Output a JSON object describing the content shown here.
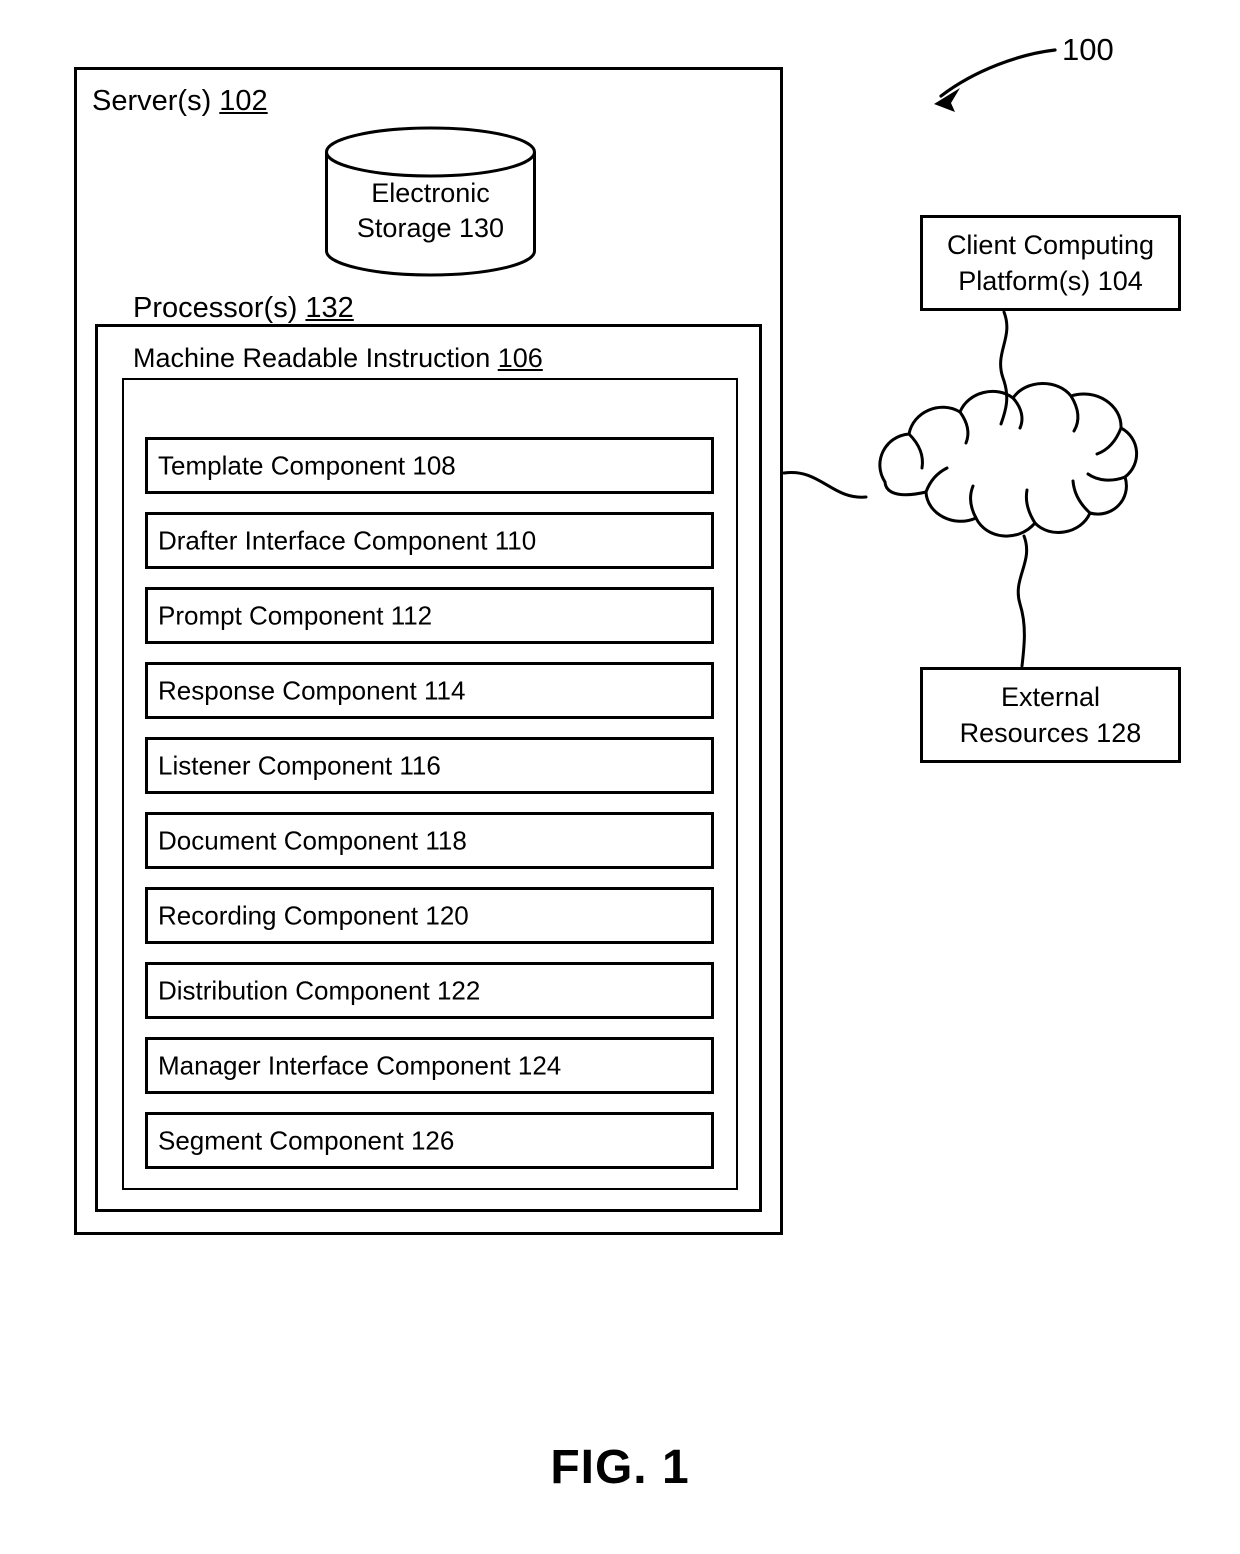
{
  "figure": {
    "caption": "FIG. 1",
    "reference_numeral": "100"
  },
  "server": {
    "label": "Server(s)",
    "ref": "102"
  },
  "storage": {
    "line1": "Electronic",
    "line2": "Storage",
    "ref": "130"
  },
  "processor": {
    "label": "Processor(s)",
    "ref": "132"
  },
  "machine_readable_instruction": {
    "label": "Machine Readable Instruction",
    "ref": "106"
  },
  "components": [
    {
      "label": "Template Component",
      "ref": "108"
    },
    {
      "label": "Drafter Interface Component",
      "ref": "110"
    },
    {
      "label": "Prompt Component",
      "ref": "112"
    },
    {
      "label": "Response Component",
      "ref": "114"
    },
    {
      "label": "Listener Component",
      "ref": "116"
    },
    {
      "label": "Document Component",
      "ref": "118"
    },
    {
      "label": "Recording Component",
      "ref": "120"
    },
    {
      "label": "Distribution Component",
      "ref": "122"
    },
    {
      "label": "Manager Interface Component",
      "ref": "124"
    },
    {
      "label": "Segment Component",
      "ref": "126"
    }
  ],
  "client_platform": {
    "line1": "Client Computing",
    "line2": "Platform(s)",
    "ref": "104"
  },
  "external_resources": {
    "line1": "External",
    "line2": "Resources",
    "ref": "128"
  },
  "network_cloud": {
    "label": "network-cloud"
  },
  "colors": {
    "stroke": "#000000",
    "background": "#ffffff"
  }
}
